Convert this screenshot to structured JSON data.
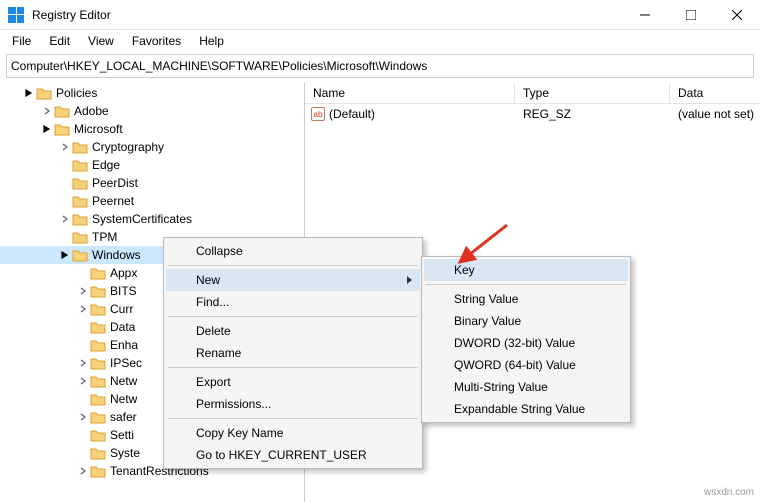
{
  "window": {
    "title": "Registry Editor"
  },
  "menu": {
    "file": "File",
    "edit": "Edit",
    "view": "View",
    "favorites": "Favorites",
    "help": "Help"
  },
  "address": {
    "label": "Computer",
    "path": "\\HKEY_LOCAL_MACHINE\\SOFTWARE\\Policies\\Microsoft\\Windows"
  },
  "list": {
    "headers": {
      "name": "Name",
      "type": "Type",
      "data": "Data"
    },
    "rows": [
      {
        "icon": "ab",
        "name": "(Default)",
        "type": "REG_SZ",
        "data": "(value not set)"
      }
    ]
  },
  "tree": {
    "policies": "Policies",
    "adobe": "Adobe",
    "microsoft": "Microsoft",
    "cryptography": "Cryptography",
    "edge": "Edge",
    "peerdist": "PeerDist",
    "peernet": "Peernet",
    "systemcertificates": "SystemCertificates",
    "tpm": "TPM",
    "windows": "Windows",
    "appx": "Appx",
    "bits": "BITS",
    "curr": "Curr",
    "data": "Data",
    "enha": "Enha",
    "ipsec": "IPSec",
    "netw1": "Netw",
    "netw2": "Netw",
    "safer": "safer",
    "setti": "Setti",
    "syste": "Syste",
    "tenant": "TenantRestrictions"
  },
  "context": {
    "collapse": "Collapse",
    "new": "New",
    "find": "Find...",
    "delete": "Delete",
    "rename": "Rename",
    "export": "Export",
    "permissions": "Permissions...",
    "copykey": "Copy Key Name",
    "gohkcu": "Go to HKEY_CURRENT_USER"
  },
  "submenu": {
    "key": "Key",
    "string": "String Value",
    "binary": "Binary Value",
    "dword": "DWORD (32-bit) Value",
    "qword": "QWORD (64-bit) Value",
    "multi": "Multi-String Value",
    "expand": "Expandable String Value"
  },
  "watermark": "wsxdn.com"
}
